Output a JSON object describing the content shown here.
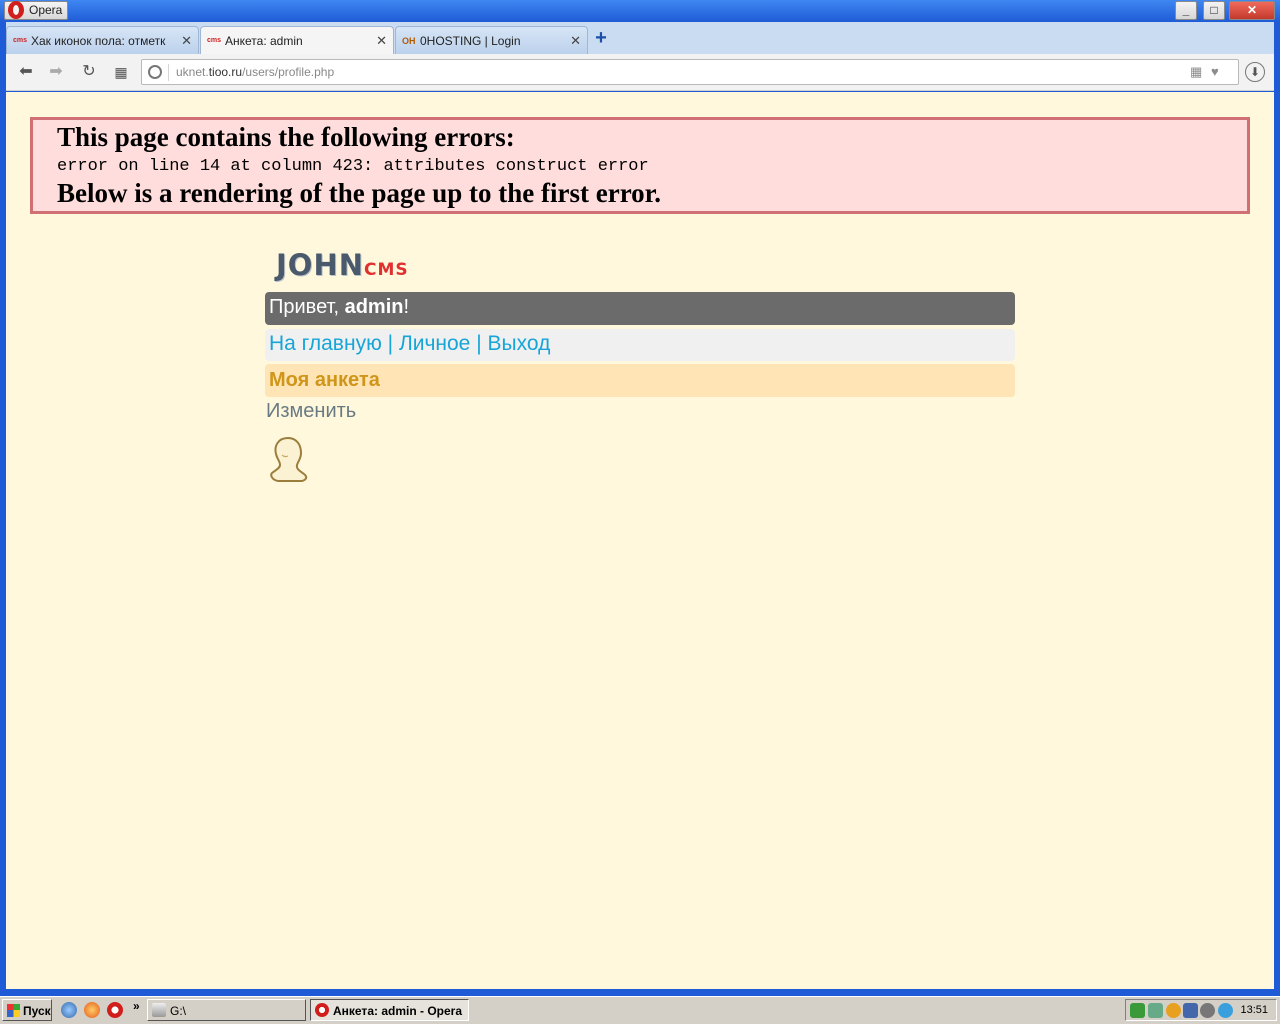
{
  "window": {
    "app_button": "Opera"
  },
  "tabs": [
    {
      "icon": "cms",
      "title": "Хак иконок пола: отметк",
      "active": false
    },
    {
      "icon": "cms",
      "title": "Анкета: admin",
      "active": true
    },
    {
      "icon": "OH",
      "title": "0HOSTING | Login",
      "active": false
    }
  ],
  "address": {
    "url_prefix": "uknet.",
    "url_host": "tioo.ru",
    "url_path": "/users/profile.php"
  },
  "error": {
    "heading": "This page contains the following errors:",
    "detail": "error on line 14 at column 423: attributes construct error",
    "footer": "Below is a rendering of the page up to the first error."
  },
  "site": {
    "logo_main": "JOHN",
    "logo_sub": "CMS",
    "greeting_prefix": "Привет, ",
    "greeting_user": "admin",
    "greeting_suffix": "!",
    "menu": [
      {
        "label": "На главную"
      },
      {
        "label": "Личное"
      },
      {
        "label": "Выход"
      }
    ],
    "menu_separator": " | ",
    "section_title": "Моя анкета",
    "edit_link": "Изменить"
  },
  "taskbar": {
    "start_label": "Пуск",
    "chevron": "»",
    "tasks": [
      {
        "label": "G:\\",
        "active": false
      },
      {
        "label": "Анкета: admin - Opera",
        "active": true
      }
    ],
    "clock": "13:51"
  },
  "colors": {
    "page_bg": "#fff8dc",
    "error_bg": "#ffdddd",
    "error_border": "#d07074",
    "greeting_bg": "#6b6b6b",
    "menu_link": "#17a5d8",
    "section_bg": "#ffe4b5",
    "section_text": "#d0961a"
  }
}
